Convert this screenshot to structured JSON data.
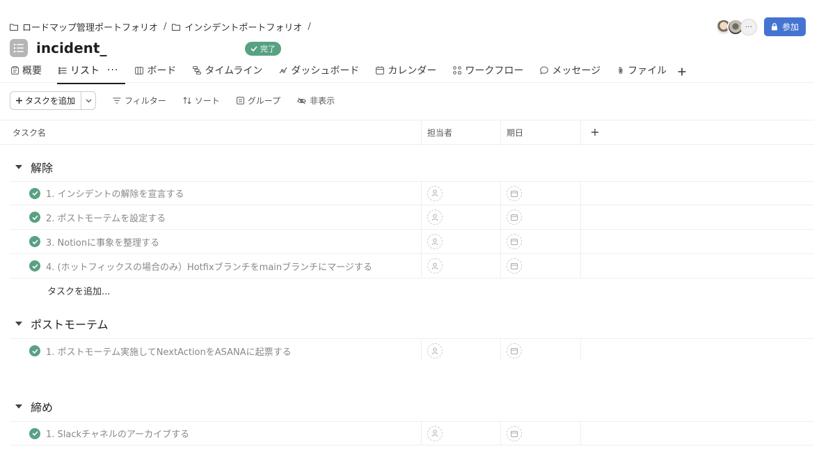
{
  "breadcrumb": [
    {
      "label": "ロードマップ管理ポートフォリオ",
      "icon": "folder-icon"
    },
    {
      "label": "インシデントポートフォリオ",
      "icon": "folder-icon"
    }
  ],
  "breadcrumb_separator": "/",
  "project": {
    "title": "incident_",
    "status": "完了",
    "status_color": "#58a182"
  },
  "header": {
    "more_label": "···",
    "join_label": "参加",
    "join_color": "#4573d2"
  },
  "tabs": [
    {
      "label": "概要",
      "icon": "overview-icon"
    },
    {
      "label": "リスト",
      "icon": "list-icon",
      "active": true,
      "menu": "···"
    },
    {
      "label": "ボード",
      "icon": "board-icon"
    },
    {
      "label": "タイムライン",
      "icon": "timeline-icon"
    },
    {
      "label": "ダッシュボード",
      "icon": "dashboard-icon"
    },
    {
      "label": "カレンダー",
      "icon": "calendar-icon"
    },
    {
      "label": "ワークフロー",
      "icon": "workflow-icon"
    },
    {
      "label": "メッセージ",
      "icon": "message-icon"
    },
    {
      "label": "ファイル",
      "icon": "file-icon"
    }
  ],
  "toolbar": {
    "add_task": "タスクを追加",
    "filter": "フィルター",
    "sort": "ソート",
    "group": "グループ",
    "hide": "非表示"
  },
  "columns": {
    "task": "タスク名",
    "assignee": "担当者",
    "due": "期日"
  },
  "sections": [
    {
      "name": "解除",
      "tasks": [
        "1. インシデントの解除を宣言する",
        "2. ポストモーテムを設定する",
        "3. Notionに事象を整理する",
        "4. (ホットフィックスの場合のみ）Hotfixブランチをmainブランチにマージする"
      ],
      "add_task": "タスクを追加..."
    },
    {
      "name": "ポストモーテム",
      "tasks": [
        "1. ポストモーテム実施してNextActionをASANAに起票する"
      ]
    },
    {
      "name": "締め",
      "tasks": [
        "1. Slackチャネルのアーカイブする"
      ]
    }
  ]
}
